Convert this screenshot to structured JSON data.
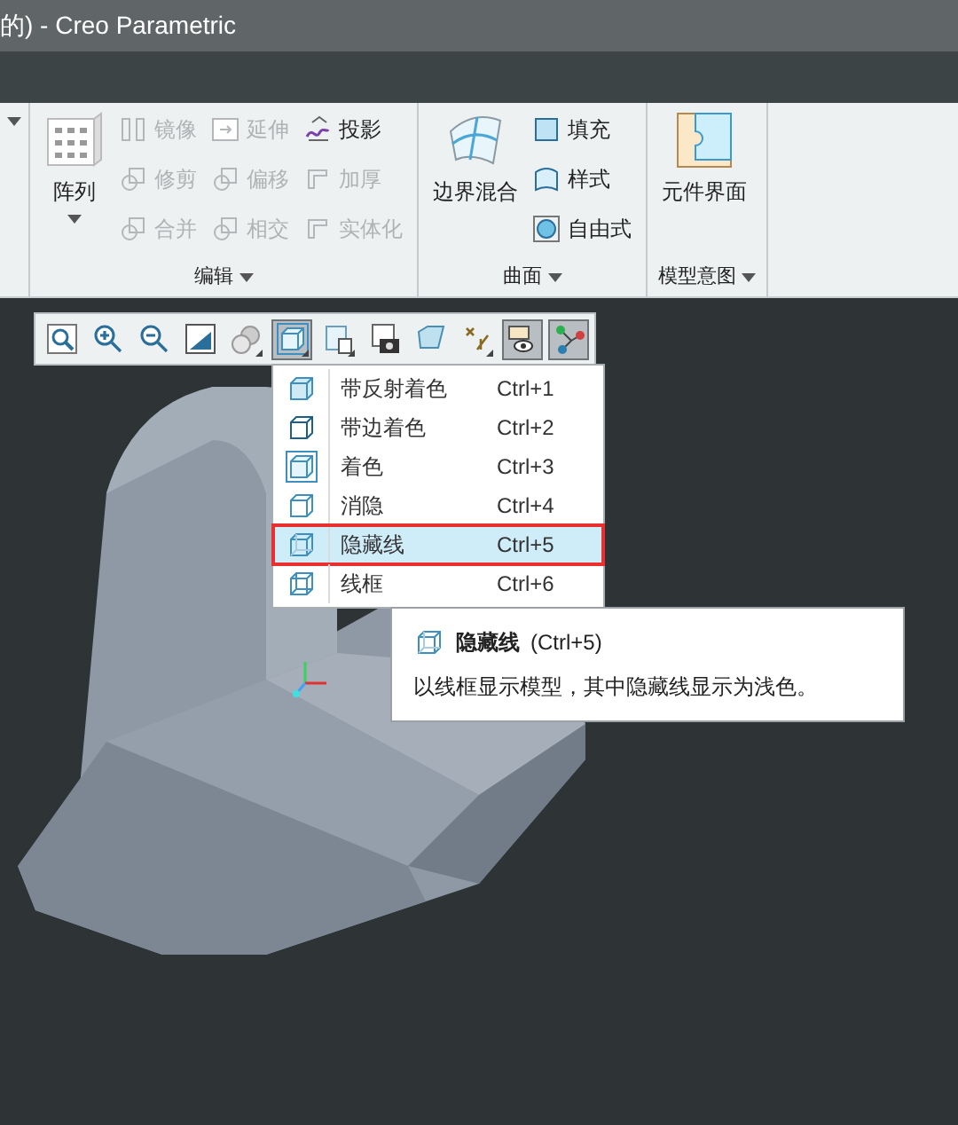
{
  "window": {
    "title": "的) - Creo Parametric"
  },
  "ribbon": {
    "groups": [
      {
        "label": "编辑",
        "large": {
          "label": "阵列",
          "disabled": false
        },
        "columns": [
          [
            {
              "label": "镜像",
              "disabled": true
            },
            {
              "label": "修剪",
              "disabled": true
            },
            {
              "label": "合并",
              "disabled": true
            }
          ],
          [
            {
              "label": "延伸",
              "disabled": true
            },
            {
              "label": "偏移",
              "disabled": true
            },
            {
              "label": "相交",
              "disabled": true
            }
          ],
          [
            {
              "label": "投影",
              "disabled": false
            },
            {
              "label": "加厚",
              "disabled": true
            },
            {
              "label": "实体化",
              "disabled": true
            }
          ]
        ]
      },
      {
        "label": "曲面",
        "large": {
          "label": "边界混合",
          "disabled": false
        },
        "columns": [
          [
            {
              "label": "填充",
              "disabled": false
            },
            {
              "label": "样式",
              "disabled": false
            },
            {
              "label": "自由式",
              "disabled": false
            }
          ]
        ]
      },
      {
        "label": "模型意图",
        "large": {
          "label": "元件界面",
          "disabled": false
        }
      }
    ]
  },
  "view_toolbar": {
    "buttons": [
      {
        "selected": false,
        "has_menu": false
      },
      {
        "selected": false,
        "has_menu": false
      },
      {
        "selected": false,
        "has_menu": false
      },
      {
        "selected": false,
        "has_menu": false
      },
      {
        "selected": false,
        "has_menu": true
      },
      {
        "selected": true,
        "has_menu": true
      },
      {
        "selected": false,
        "has_menu": true
      },
      {
        "selected": false,
        "has_menu": false
      },
      {
        "selected": false,
        "has_menu": false
      },
      {
        "selected": false,
        "has_menu": true
      },
      {
        "selected": true,
        "has_menu": false
      },
      {
        "selected": true,
        "has_menu": false
      }
    ]
  },
  "display_menu": {
    "items": [
      {
        "label": "带反射着色",
        "shortcut": "Ctrl+1",
        "selected": false
      },
      {
        "label": "带边着色",
        "shortcut": "Ctrl+2",
        "selected": false
      },
      {
        "label": "着色",
        "shortcut": "Ctrl+3",
        "selected": false
      },
      {
        "label": "消隐",
        "shortcut": "Ctrl+4",
        "selected": false
      },
      {
        "label": "隐藏线",
        "shortcut": "Ctrl+5",
        "selected": true
      },
      {
        "label": "线框",
        "shortcut": "Ctrl+6",
        "selected": false
      }
    ]
  },
  "tooltip": {
    "title": "隐藏线",
    "shortcut": "(Ctrl+5)",
    "description": "以线框显示模型，其中隐藏线显示为浅色。"
  }
}
